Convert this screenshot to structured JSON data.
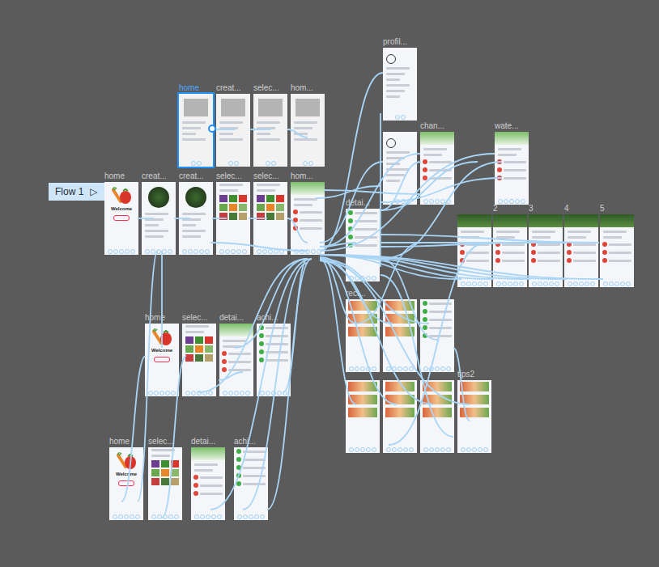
{
  "flow": {
    "label": "Flow 1",
    "icon": "▷"
  },
  "frames": [
    {
      "label": "home",
      "selected": true,
      "kind": "wireframe"
    },
    {
      "label": "creat...",
      "selected": false,
      "kind": "wireframe"
    },
    {
      "label": "selec...",
      "selected": false,
      "kind": "wireframe"
    },
    {
      "label": "hom...",
      "selected": false,
      "kind": "wireframe"
    },
    {
      "label": "profil...",
      "selected": false,
      "kind": "profile"
    },
    {
      "label": "",
      "selected": false,
      "kind": "profile"
    },
    {
      "label": "chan...",
      "selected": false,
      "kind": "plant"
    },
    {
      "label": "wate...",
      "selected": false,
      "kind": "plant"
    },
    {
      "label": "home",
      "selected": false,
      "kind": "welcome",
      "title": "Welcome"
    },
    {
      "label": "creat...",
      "selected": false,
      "kind": "create"
    },
    {
      "label": "creat...",
      "selected": false,
      "kind": "create"
    },
    {
      "label": "selec...",
      "selected": false,
      "kind": "select"
    },
    {
      "label": "selec...",
      "selected": false,
      "kind": "select"
    },
    {
      "label": "hom...",
      "selected": false,
      "kind": "plant"
    },
    {
      "label": "detai...",
      "selected": false,
      "kind": "list"
    },
    {
      "label": "",
      "selected": false,
      "kind": "garden"
    },
    {
      "label": "2",
      "selected": false,
      "kind": "garden"
    },
    {
      "label": "3",
      "selected": false,
      "kind": "garden"
    },
    {
      "label": "4",
      "selected": false,
      "kind": "garden"
    },
    {
      "label": "5",
      "selected": false,
      "kind": "garden"
    },
    {
      "label": "reci...",
      "selected": false,
      "kind": "recipe"
    },
    {
      "label": "",
      "selected": false,
      "kind": "recipe"
    },
    {
      "label": "",
      "selected": false,
      "kind": "list"
    },
    {
      "label": "",
      "selected": false,
      "kind": "recipe"
    },
    {
      "label": "",
      "selected": false,
      "kind": "recipe"
    },
    {
      "label": "",
      "selected": false,
      "kind": "recipe"
    },
    {
      "label": "tips2",
      "selected": false,
      "kind": "recipe"
    },
    {
      "label": "home",
      "selected": false,
      "kind": "welcome",
      "title": "Welcome"
    },
    {
      "label": "selec...",
      "selected": false,
      "kind": "select"
    },
    {
      "label": "detai...",
      "selected": false,
      "kind": "plant"
    },
    {
      "label": "achi...",
      "selected": false,
      "kind": "list"
    },
    {
      "label": "home",
      "selected": false,
      "kind": "welcome",
      "title": "Welcome"
    },
    {
      "label": "selec...",
      "selected": false,
      "kind": "select"
    },
    {
      "label": "detai...",
      "selected": false,
      "kind": "plant"
    },
    {
      "label": "achi...",
      "selected": false,
      "kind": "list"
    }
  ]
}
